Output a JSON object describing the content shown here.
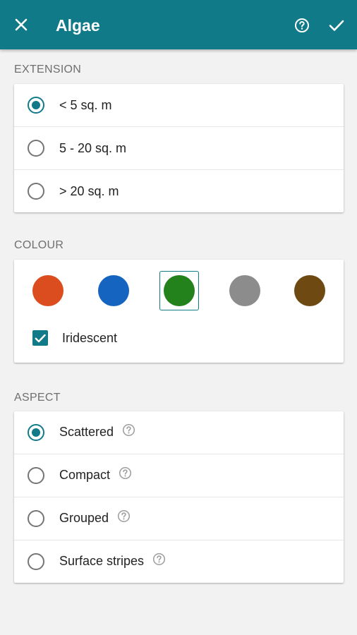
{
  "appbar": {
    "title": "Algae",
    "close_icon": "close-icon",
    "help_icon": "help-circle-icon",
    "confirm_icon": "check-icon",
    "color": "#117a88"
  },
  "extension": {
    "title": "EXTENSION",
    "options": [
      {
        "label": "< 5 sq. m",
        "selected": true
      },
      {
        "label": "5 - 20 sq. m",
        "selected": false
      },
      {
        "label": "> 20 sq. m",
        "selected": false
      }
    ]
  },
  "colour": {
    "title": "COLOUR",
    "swatches": [
      {
        "color": "#db4c1e",
        "selected": false
      },
      {
        "color": "#1565c0",
        "selected": false
      },
      {
        "color": "#24821d",
        "selected": true
      },
      {
        "color": "#8c8c8c",
        "selected": false
      },
      {
        "color": "#6e4a12",
        "selected": false
      }
    ],
    "iridescent": {
      "label": "Iridescent",
      "checked": true
    }
  },
  "aspect": {
    "title": "ASPECT",
    "options": [
      {
        "label": "Scattered",
        "selected": true
      },
      {
        "label": "Compact",
        "selected": false
      },
      {
        "label": "Grouped",
        "selected": false
      },
      {
        "label": "Surface stripes",
        "selected": false
      }
    ]
  }
}
